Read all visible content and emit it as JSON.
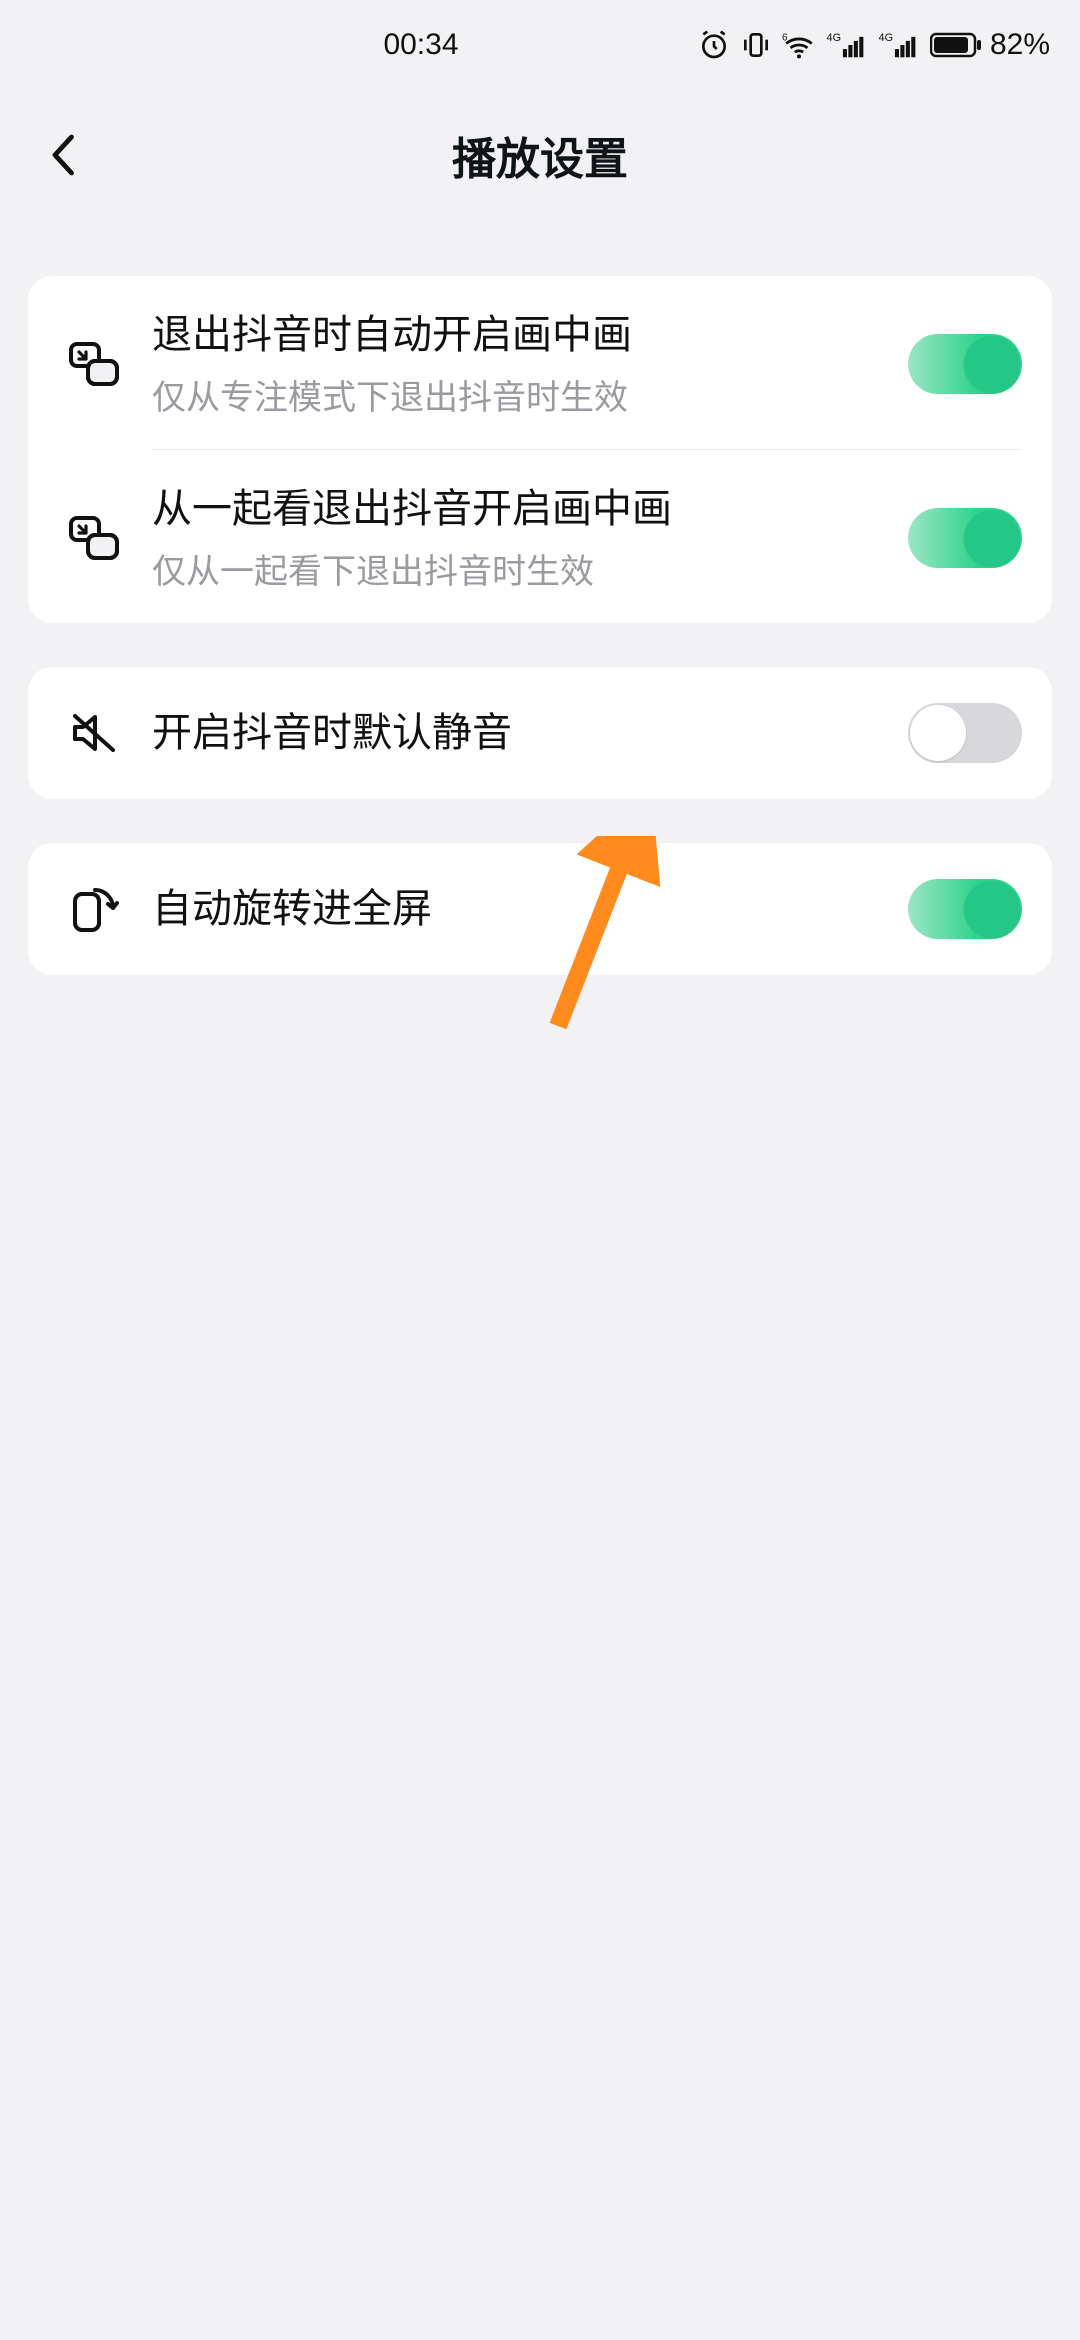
{
  "status": {
    "time": "00:34",
    "battery_text": "82%"
  },
  "header": {
    "title": "播放设置"
  },
  "groups": [
    {
      "rows": [
        {
          "icon": "pip-icon",
          "label": "退出抖音时自动开启画中画",
          "sublabel": "仅从专注模式下退出抖音时生效",
          "toggle": "on"
        },
        {
          "icon": "pip-icon",
          "label": "从一起看退出抖音开启画中画",
          "sublabel": "仅从一起看下退出抖音时生效",
          "toggle": "on"
        }
      ]
    },
    {
      "rows": [
        {
          "icon": "mute-icon",
          "label": "开启抖音时默认静音",
          "toggle": "off"
        }
      ]
    },
    {
      "rows": [
        {
          "icon": "rotate-icon",
          "label": "自动旋转进全屏",
          "toggle": "on"
        }
      ]
    }
  ]
}
